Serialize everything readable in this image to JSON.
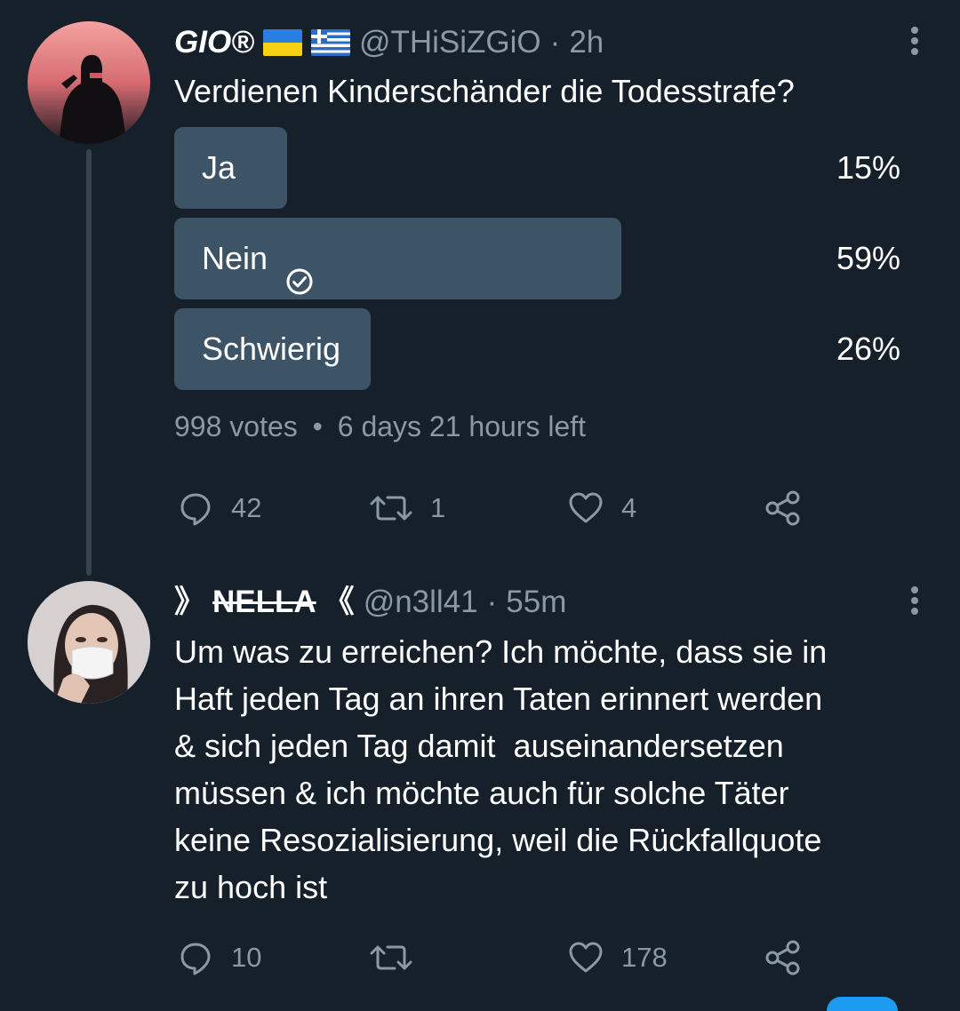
{
  "tweet1": {
    "display_name": "GIO®",
    "flags": [
      "ukraine-flag",
      "greece-flag"
    ],
    "handle": "@THiSiZGiO",
    "separator": "·",
    "time": "2h",
    "text": "Verdienen Kinderschänder die Todesstrafe?",
    "poll": {
      "options": [
        {
          "label": "Ja",
          "percent_label": "15%",
          "percent": 15,
          "selected": false
        },
        {
          "label": "Nein",
          "percent_label": "59%",
          "percent": 59,
          "selected": true
        },
        {
          "label": "Schwierig",
          "percent_label": "26%",
          "percent": 26,
          "selected": false
        }
      ],
      "votes": "998 votes",
      "meta_separator": "•",
      "time_left": "6 days 21 hours left"
    },
    "actions": {
      "replies": "42",
      "retweets": "1",
      "likes": "4"
    }
  },
  "tweet2": {
    "display_name_prefix": "》",
    "display_name_core": "NELLA",
    "display_name_suffix": "《",
    "handle": "@n3ll41",
    "separator": "·",
    "time": "55m",
    "text": "Um was zu erreichen? Ich möchte, dass sie in\nHaft jeden Tag an ihren Taten erinnert werden\n& sich jeden Tag damit  auseinandersetzen\nmüssen & ich möchte auch für solche Täter\nkeine Resozialisierung, weil die Rückfallquote\nzu hoch ist",
    "actions": {
      "replies": "10",
      "retweets": "",
      "likes": "178"
    }
  },
  "colors": {
    "background": "#15202b",
    "poll_bar": "#3d5466",
    "secondary_text": "#8b98a5",
    "accent": "#1d9bf0"
  },
  "icons": {
    "reply": "reply-icon",
    "retweet": "retweet-icon",
    "like": "heart-icon",
    "share": "share-icon",
    "more": "more-icon",
    "check": "check-circle-icon"
  }
}
